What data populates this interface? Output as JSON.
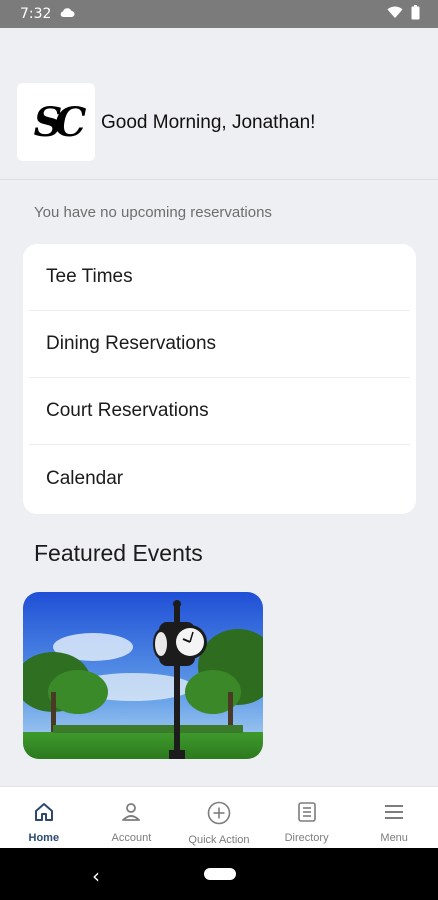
{
  "status": {
    "time": "7:32"
  },
  "header": {
    "logo_text": "SC",
    "greeting": "Good Morning, Jonathan!"
  },
  "reservations": {
    "empty_text": "You have no upcoming reservations"
  },
  "quick_links": [
    {
      "label": "Tee Times"
    },
    {
      "label": "Dining Reservations"
    },
    {
      "label": "Court Reservations"
    },
    {
      "label": "Calendar"
    }
  ],
  "featured": {
    "title": "Featured Events"
  },
  "bottom_nav": [
    {
      "label": "Home",
      "icon": "home-icon",
      "active": true
    },
    {
      "label": "Account",
      "icon": "account-icon",
      "active": false
    },
    {
      "label": "Quick Action",
      "icon": "plus-circle-icon",
      "active": false
    },
    {
      "label": "Directory",
      "icon": "directory-icon",
      "active": false
    },
    {
      "label": "Menu",
      "icon": "menu-icon",
      "active": false
    }
  ],
  "colors": {
    "accent": "#2c4a70",
    "status_bar": "#7b7b7b",
    "background": "#eeeff2"
  }
}
